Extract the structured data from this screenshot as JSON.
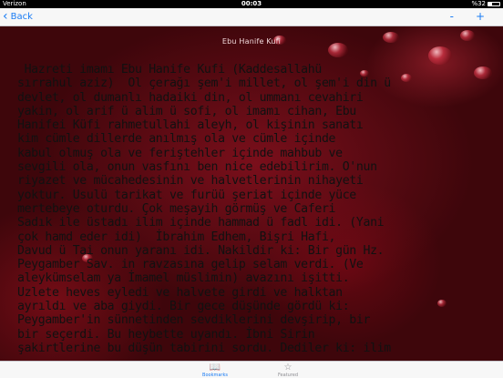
{
  "status_bar": {
    "carrier": "Verizon",
    "time": "00:03",
    "battery_text": "%32",
    "battery_level": 0.32
  },
  "nav": {
    "back_label": "Back",
    "font_smaller_label": "-",
    "font_larger_label": "+"
  },
  "chapter": {
    "title": "Ebu Hanife Kufi",
    "lines": [
      " Hazreti imamı Ebu Hanife Kufi (Kaddesallahü",
      "sırrahul aziz)  Ol çerağı şem'i millet, ol şem'i din ü",
      "devlet, ol dumanlı hadaiki din, ol ummanı cevahiri",
      "yakin, ol arif ü alim ü sofi, ol imamı cihan, Ebu",
      "Hanifei Küfi rahmetullahi aleyh, ol kişinin sanatı",
      "kim cümle dillerde anılmış ola ve cümle içinde",
      "kabul olmuş ola ve feriştehler içinde mahbub ve",
      "sevgili ola, onun vasfını ben nice edebilirim. O'nun",
      "riyazet ve mücahedesinin ve halvetlerinin nihayeti",
      "yoktur. Usulü tarikat ve furüü şeriat içinde yüce",
      "mertebeye oturdu. Çok meşayih görmüş ve Caferi",
      "Sadık ile üstadı ilim içinde hammad ü fadl idi. (Yani",
      "çok hamd eder idi)  İbrahim Edhem, Bişri Hafi,",
      "Davud ü Tai onun yaranı idi. Nakildir ki: Bir gün Hz.",
      "Peygamber Sav. in ravzasına gelip selam verdi. (Ve",
      "aleykümselam ya İmamel müslimin) avazını işitti.",
      "Uzlete heves eyledi ve halvete girdi ve halktan",
      "ayrıldı ve aba giydi. Bir gece düşünde gördü ki:",
      "Peygamber'in sünnetinden sevdiklerini devşirip, bir",
      "bir seçerdi. Bu heybette uyandı. İbni Sirin",
      "şakirtlerine bu düşün tabirini sordu. Dediler ki: ilim"
    ]
  },
  "tabs": [
    {
      "label": "Bookmarks",
      "icon": "book-icon",
      "active": true
    },
    {
      "label": "Featured",
      "icon": "star-icon",
      "active": false
    }
  ],
  "colors": {
    "accent": "#1a7cf4",
    "background": "#7a0f1b"
  }
}
